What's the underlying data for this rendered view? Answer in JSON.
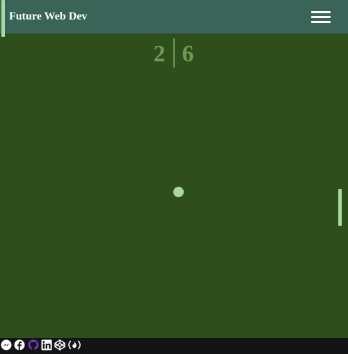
{
  "header": {
    "brand": "Future Web Dev",
    "menu_icon": "hamburger-menu-icon"
  },
  "game": {
    "score": {
      "left": "2",
      "right": "6"
    },
    "paddle_color": "#a8d89a",
    "ball_color": "#a8d89a",
    "field_color": "#2e4e1c",
    "score_color": "#6f9a58"
  },
  "footer": {
    "social_icons": [
      "messenger-icon",
      "facebook-icon",
      "github-icon",
      "linkedin-icon",
      "codepen-icon",
      "freecodecamp-icon"
    ],
    "github_color": "#6e40c9"
  }
}
